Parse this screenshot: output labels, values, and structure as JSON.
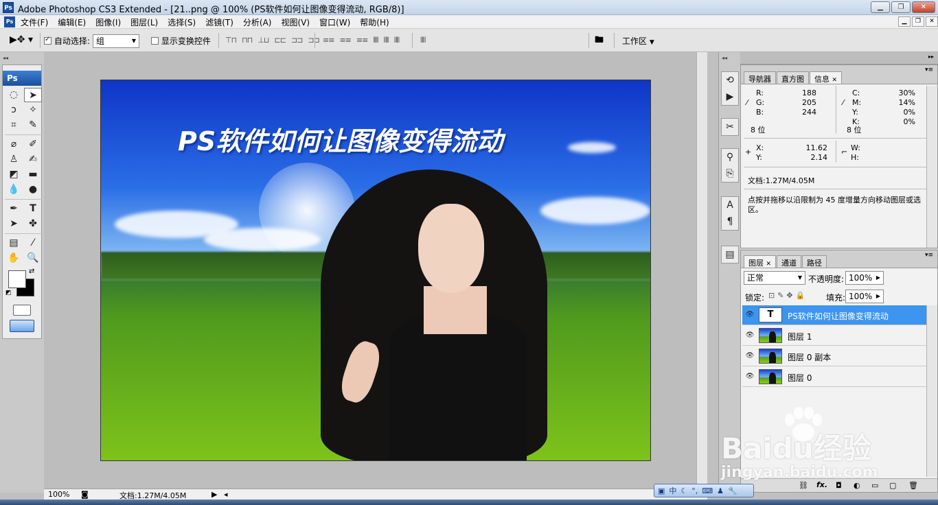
{
  "window": {
    "title": "Adobe Photoshop CS3 Extended - [21..png @ 100% (PS软件如何让图像变得流动, RGB/8)]",
    "logo": "Ps"
  },
  "menu": {
    "items": [
      "文件(F)",
      "编辑(E)",
      "图像(I)",
      "图层(L)",
      "选择(S)",
      "滤镜(T)",
      "分析(A)",
      "视图(V)",
      "窗口(W)",
      "帮助(H)"
    ]
  },
  "options": {
    "auto_select_label": "自动选择:",
    "auto_select_checked": true,
    "auto_select_value": "组",
    "show_transform_label": "显示变换控件",
    "show_transform_checked": false,
    "workspace_label": "工作区"
  },
  "toolbox": {
    "header": "Ps"
  },
  "canvas": {
    "headline": "PS软件如何让图像变得流动"
  },
  "status": {
    "zoom": "100%",
    "doc": "文档:1.27M/4.05M"
  },
  "info_panel": {
    "tabs": [
      "导航器",
      "直方图",
      "信息"
    ],
    "active_tab": "信息",
    "rgb": {
      "R": "188",
      "G": "205",
      "B": "244"
    },
    "cmyk": {
      "C": "30%",
      "M": "14%",
      "Y": "0%",
      "K": "0%"
    },
    "bit_left": "8 位",
    "bit_right": "8 位",
    "x_label": "X:",
    "x_value": "11.62",
    "y_label": "Y:",
    "y_value": "2.14",
    "w_label": "W:",
    "h_label": "H:",
    "doc": "文档:1.27M/4.05M",
    "hint": "点按并拖移以沿限制为 45 度增量方向移动图层或选区。"
  },
  "layers_panel": {
    "tabs": [
      "图层",
      "通道",
      "路径"
    ],
    "active_tab": "图层",
    "blend_mode": "正常",
    "opacity_label": "不透明度:",
    "opacity_value": "100%",
    "lock_label": "锁定:",
    "fill_label": "填充:",
    "fill_value": "100%",
    "layers": [
      {
        "name": "PS软件如何让图像变得流动",
        "type": "text",
        "thumb": "T",
        "selected": true
      },
      {
        "name": "图层 1",
        "type": "image",
        "selected": false
      },
      {
        "name": "图层 0 副本",
        "type": "image",
        "selected": false
      },
      {
        "name": "图层 0",
        "type": "image",
        "selected": false
      }
    ],
    "footer_fx": "fx."
  },
  "ime": {
    "lang": "中"
  },
  "watermark": {
    "brand": "Baidu经验",
    "url": "jingyan.baidu.com"
  },
  "colors": {
    "selected_layer": "#3d95f0",
    "ps_blue": "#1c4f9c",
    "foreground": "#ffffff",
    "background": "#000000"
  }
}
